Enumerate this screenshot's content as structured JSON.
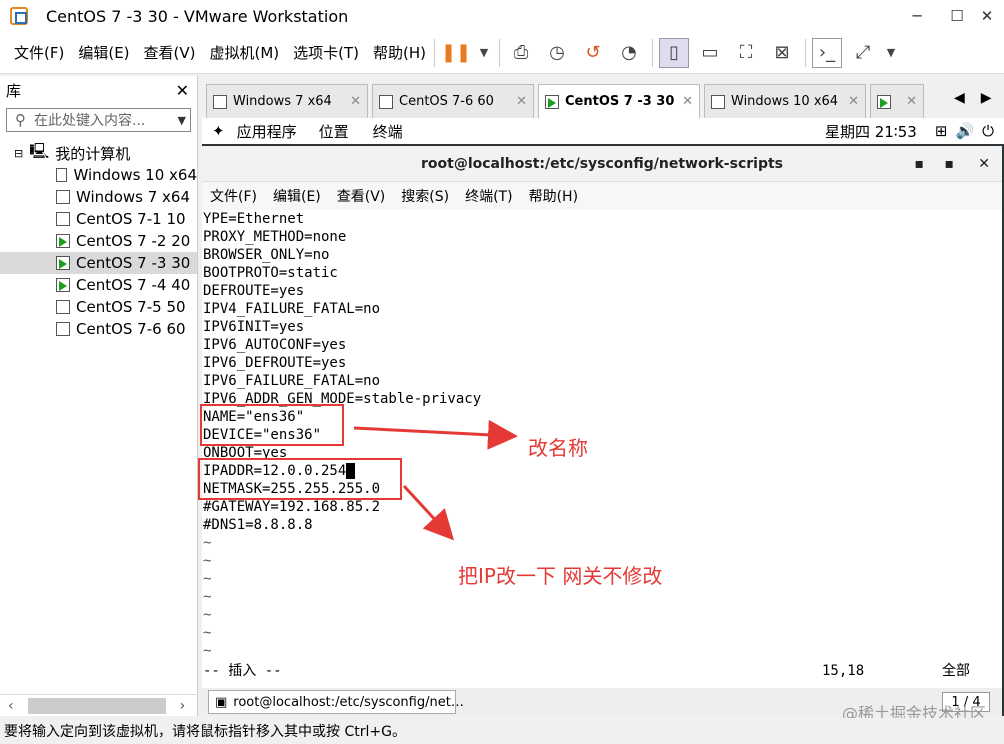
{
  "window": {
    "title": "CentOS 7 -3 30 - VMware Workstation"
  },
  "menu": {
    "items": [
      "文件(F)",
      "编辑(E)",
      "查看(V)",
      "虚拟机(M)",
      "选项卡(T)",
      "帮助(H)"
    ]
  },
  "library": {
    "title": "库",
    "search_placeholder": "在此处键入内容...",
    "root": "我的计算机",
    "vms": [
      {
        "name": "Windows 10 x64",
        "run": false
      },
      {
        "name": "Windows 7 x64",
        "run": false
      },
      {
        "name": "CentOS 7-1  10",
        "run": false
      },
      {
        "name": "CentOS 7 -2 20",
        "run": true
      },
      {
        "name": "CentOS 7 -3 30",
        "run": true,
        "selected": true
      },
      {
        "name": "CentOS 7 -4 40",
        "run": true
      },
      {
        "name": "CentOS 7-5 50",
        "run": false
      },
      {
        "name": "CentOS 7-6  60",
        "run": false
      }
    ]
  },
  "tabs": [
    {
      "label": "Windows 7 x64",
      "active": false
    },
    {
      "label": "CentOS 7-6  60",
      "active": false
    },
    {
      "label": "CentOS 7 -3 30",
      "active": true
    },
    {
      "label": "Windows 10 x64",
      "active": false
    }
  ],
  "gnome": {
    "apps": "应用程序",
    "places": "位置",
    "terminal": "终端",
    "clock": "星期四 21∶53"
  },
  "terminal": {
    "title": "root@localhost:/etc/sysconfig/network-scripts",
    "menu": [
      "文件(F)",
      "编辑(E)",
      "查看(V)",
      "搜索(S)",
      "终端(T)",
      "帮助(H)"
    ],
    "lines": [
      "YPE=Ethernet",
      "PROXY_METHOD=none",
      "BROWSER_ONLY=no",
      "BOOTPROTO=static",
      "DEFROUTE=yes",
      "IPV4_FAILURE_FATAL=no",
      "IPV6INIT=yes",
      "IPV6_AUTOCONF=yes",
      "IPV6_DEFROUTE=yes",
      "IPV6_FAILURE_FATAL=no",
      "IPV6_ADDR_GEN_MODE=stable-privacy",
      "NAME=\"ens36\"",
      "DEVICE=\"ens36\"",
      "ONBOOT=yes",
      "IPADDR=12.0.0.254",
      "NETMASK=255.255.255.0",
      "#GATEWAY=192.168.85.2",
      "#DNS1=8.8.8.8",
      "~",
      "~",
      "~",
      "~",
      "~",
      "~",
      "~"
    ],
    "mode": "-- 插入 --",
    "position": "15,18",
    "scroll": "全部"
  },
  "taskbar": {
    "item": "root@localhost:/etc/sysconfig/net…",
    "pager": "1 / 4"
  },
  "annotations": {
    "rename": "改名称",
    "change_ip": "把IP改一下  网关不修改"
  },
  "status": "要将输入定向到该虚拟机，请将鼠标指针移入其中或按 Ctrl+G。",
  "watermark": "@稀土掘金技术社区"
}
